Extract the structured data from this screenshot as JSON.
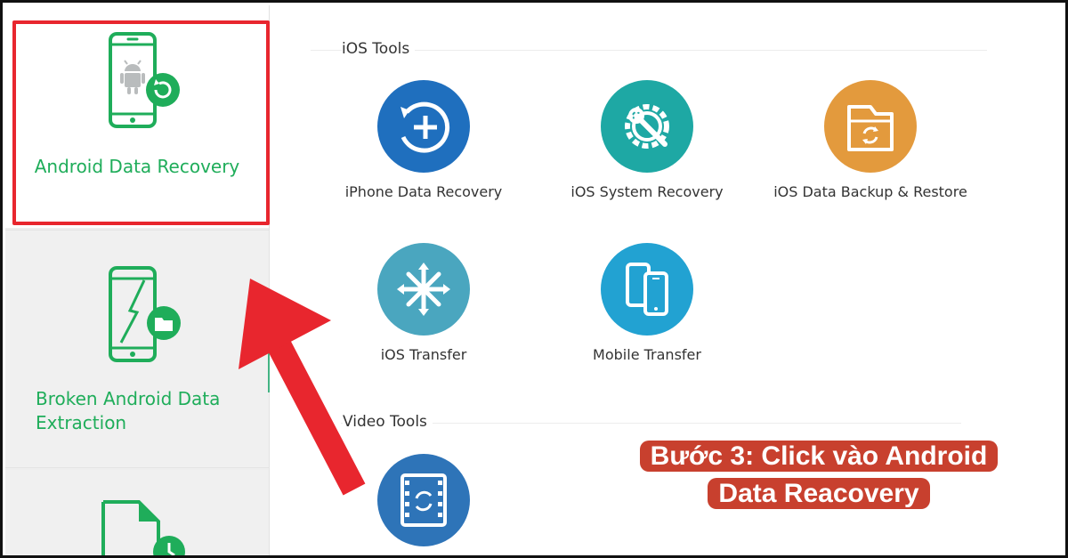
{
  "sidebar": {
    "items": [
      {
        "label": "Android Data Recovery",
        "icon": "android-phone-recovery-icon"
      },
      {
        "label": "Broken Android Data Extraction",
        "icon": "broken-phone-folder-icon"
      },
      {
        "label": "",
        "icon": "android-backup-file-icon"
      }
    ],
    "accent_color": "#1fad5a",
    "selected_index": 0
  },
  "main": {
    "ios_section": {
      "title": "iOS Tools",
      "tools": [
        {
          "label": "iPhone Data Recovery",
          "icon": "plus-restore-icon",
          "color": "#1f6fbe"
        },
        {
          "label": "iOS System Recovery",
          "icon": "gear-wrench-icon",
          "color": "#1ea8a4"
        },
        {
          "label": "iOS Data Backup & Restore",
          "icon": "folder-sync-icon",
          "color": "#e39a3d"
        },
        {
          "label": "iOS Transfer",
          "icon": "transfer-hub-icon",
          "color": "#4aa6bf"
        },
        {
          "label": "Mobile Transfer",
          "icon": "two-phones-icon",
          "color": "#22a2d2"
        }
      ]
    },
    "video_section": {
      "title": "Video Tools",
      "tools": [
        {
          "label": "",
          "icon": "film-convert-icon",
          "color": "#2e74b8"
        }
      ]
    }
  },
  "annotation": {
    "caption": "Bước 3: Click vào Android Data Reacovery",
    "caption_bg": "#c8402e",
    "highlight_color": "#e8262e"
  }
}
